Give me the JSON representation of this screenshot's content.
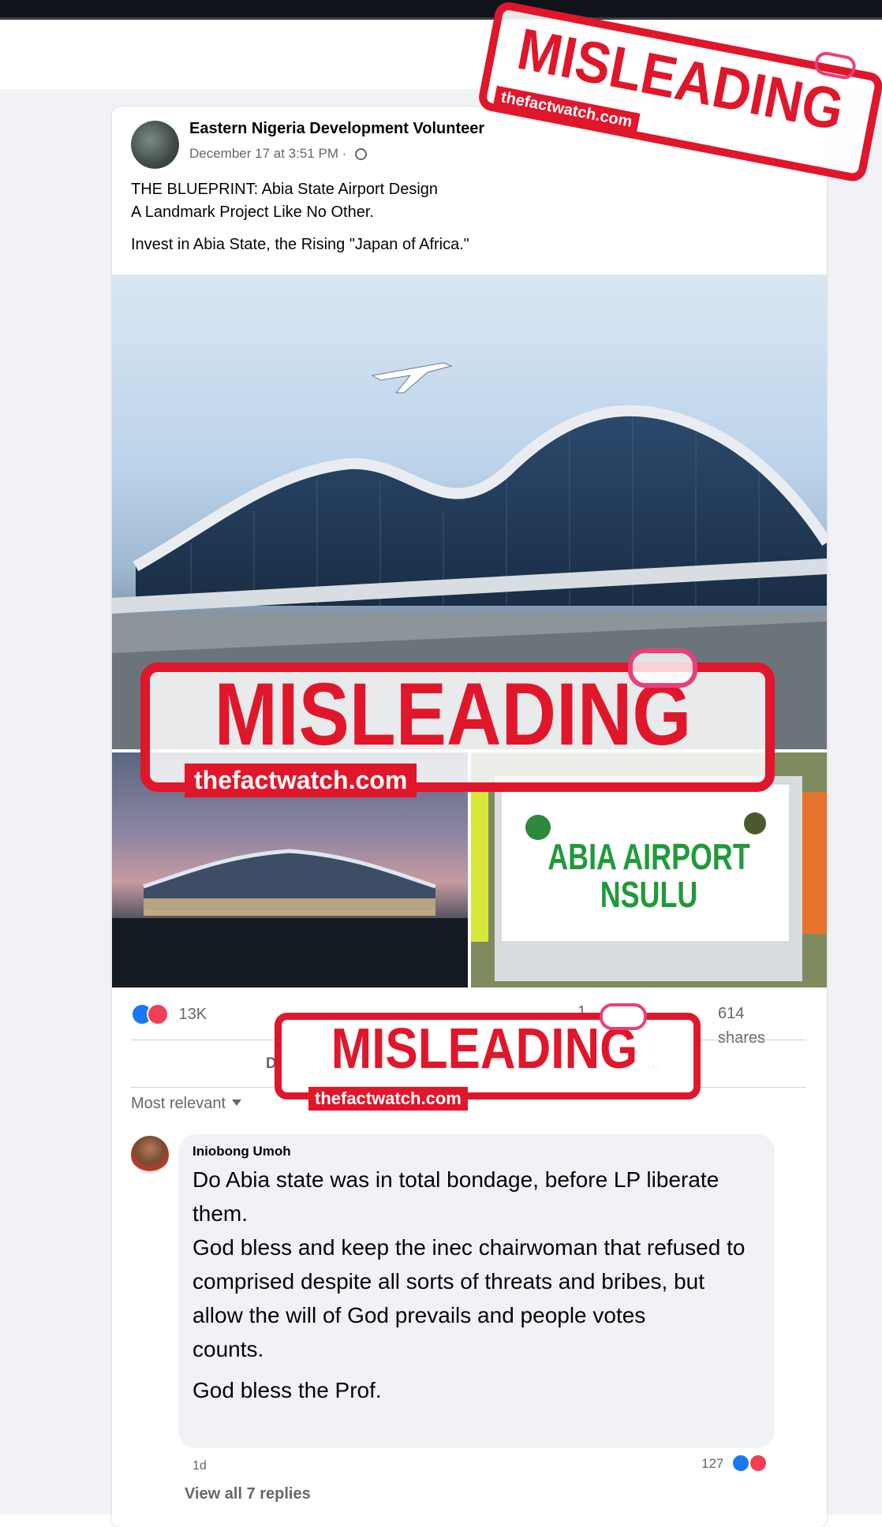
{
  "post": {
    "page_name": "Eastern Nigeria Development Volunteer",
    "timestamp": "December 17 at 3:51 PM ·",
    "text_lines": [
      "THE BLUEPRINT: Abia State Airport Design",
      "A Landmark Project Like No Other.",
      "Invest in Abia State, the Rising \"Japan of Africa.\""
    ],
    "photos": {
      "sign_line1": "ABIA AIRPORT",
      "sign_line2": "NSULU"
    },
    "reactions_count": "13K",
    "comments_count_partial": "1.",
    "shares_count": "614",
    "shares_label": "shares",
    "action_like_partial": "D",
    "action_share_partial": "..."
  },
  "comments": {
    "sort_label": "Most relevant",
    "items": [
      {
        "author": "Iniobong Umoh",
        "lines": [
          "Do Abia state was in total bondage, before LP liberate them.",
          "God bless and keep the inec chairwoman that refused to comprised despite all sorts of threats and bribes, but allow the will of God prevails and people votes",
          "counts.",
          "God bless the Prof."
        ],
        "time": "1d",
        "reactions": "127"
      }
    ],
    "view_replies": "View all 7 replies"
  },
  "watermark": {
    "word": "MISLEADING",
    "site": "thefactwatch.com"
  },
  "colors": {
    "stamp_red": "#e0162b",
    "stamp_pink": "#e8407a",
    "fb_blue": "#1877f2",
    "fb_love": "#f33e58"
  }
}
